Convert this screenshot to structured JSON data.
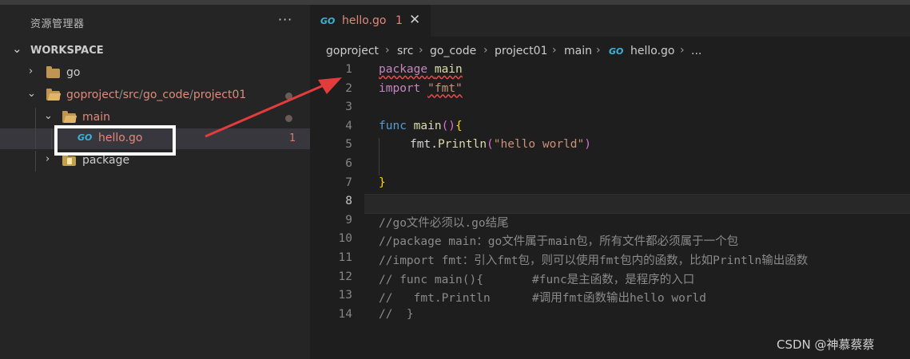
{
  "sidebar": {
    "title": "资源管理器",
    "more": "···",
    "workspace": "WORKSPACE",
    "tree": {
      "go": "go",
      "path": [
        "goproject",
        "/",
        "src",
        "/",
        "go_code",
        "/",
        "project01"
      ],
      "main": "main",
      "hello": "hello.go",
      "hello_problems": "1",
      "package": "package"
    }
  },
  "tab": {
    "icon": "GO",
    "name": "hello.go",
    "problems": "1",
    "close": "✕"
  },
  "breadcrumb": {
    "items": [
      "goproject",
      "src",
      "go_code",
      "project01",
      "main",
      "hello.go",
      "..."
    ],
    "icon": "GO"
  },
  "editor": {
    "line_numbers": [
      "1",
      "2",
      "3",
      "4",
      "5",
      "6",
      "7",
      "8",
      "9",
      "10",
      "11",
      "12",
      "13",
      "14"
    ],
    "active_line": "8",
    "code": {
      "l1_kw": "package",
      "l1_name": "main",
      "l2_kw": "import",
      "l2_str": "\"fmt\"",
      "l4_kw": "func",
      "l4_fn": "main",
      "l4_paren": "()",
      "l4_brace": "{",
      "l5_pkg": "fmt",
      "l5_dot": ".",
      "l5_fn": "Println",
      "l5_open": "(",
      "l5_str": "\"hello world\"",
      "l5_close": ")",
      "l7_brace": "}",
      "l9": "//go文件必须以.go结尾",
      "l10": "//package main：go文件属于main包，所有文件都必须属于一个包",
      "l11": "//import fmt：引入fmt包，则可以使用fmt包内的函数，比如Println输出函数",
      "l12": "// func main(){       #func是主函数，是程序的入口",
      "l13": "//   fmt.Println      #调用fmt函数输出hello world",
      "l14": "//  }"
    }
  },
  "watermark": "CSDN @神慕蔡蔡",
  "colors": {
    "accent_annotation": "#e23c3c",
    "go_icon": "#3bb3d9",
    "error_text": "#e2887a",
    "background": "#1e1e1e",
    "sidebar": "#252526"
  }
}
